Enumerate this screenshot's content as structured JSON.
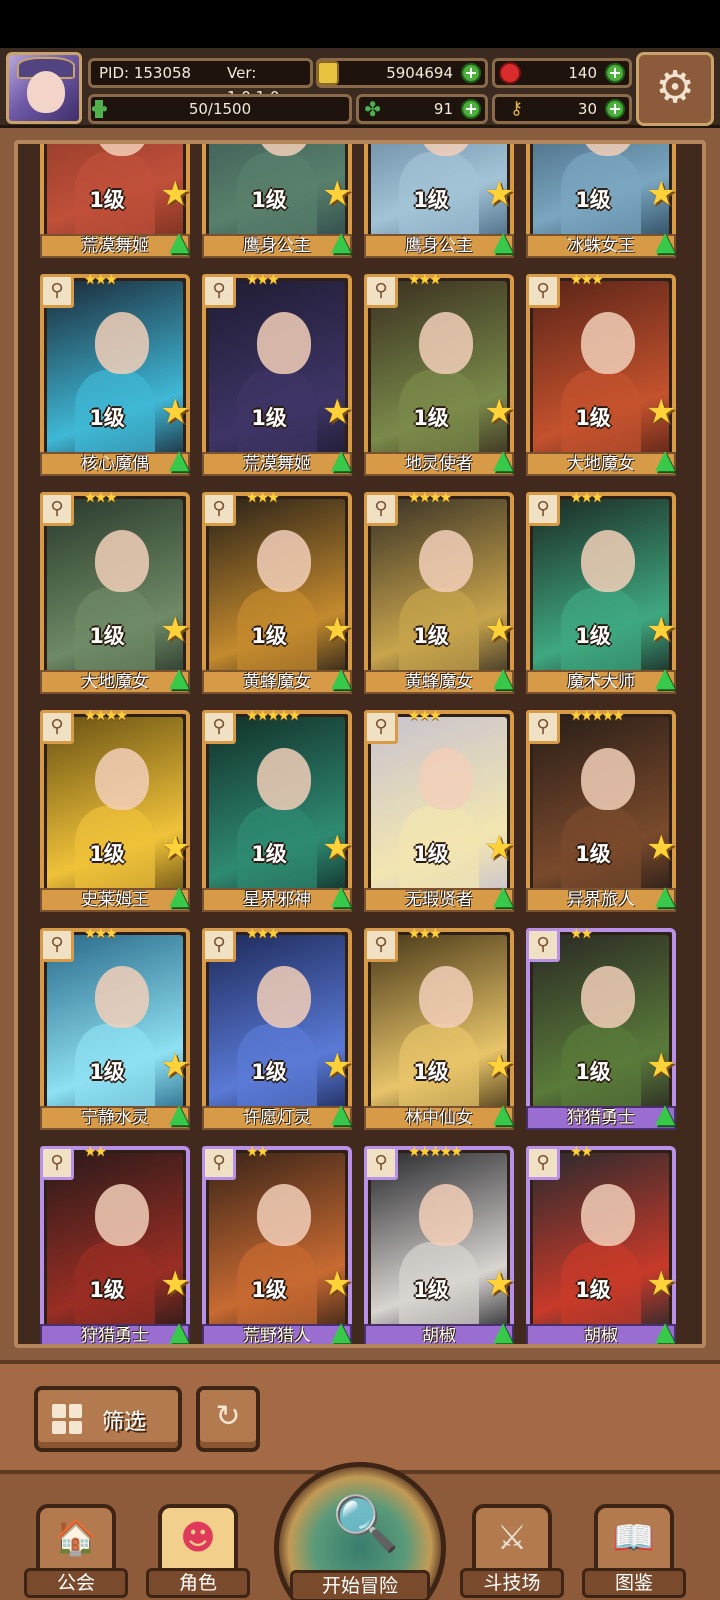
{
  "header": {
    "pid": "PID: 153058",
    "version": "Ver: 1.0.1.0",
    "gold": "5904694",
    "gems": "140",
    "exp": "50/1500",
    "exp_fraction": 0.033,
    "clovers": "91",
    "keys": "30",
    "colors": {
      "bar_bg": "#1e130d",
      "plus": "#4caf3c"
    }
  },
  "cards": [
    {
      "name": "荒漠舞姬",
      "level": "1级",
      "stars": "★★★",
      "tone": "orange",
      "art": [
        "#7a3020",
        "#c0503a"
      ]
    },
    {
      "name": "鹰身公主",
      "level": "1级",
      "stars": "★★★",
      "tone": "orange",
      "art": [
        "#2f4a4a",
        "#58806c"
      ]
    },
    {
      "name": "鹰身公主",
      "level": "1级",
      "stars": "★★★",
      "tone": "orange",
      "art": [
        "#4a6a86",
        "#a3c3d6"
      ]
    },
    {
      "name": "冰蛛女王",
      "level": "1级",
      "stars": "★★★",
      "tone": "orange",
      "art": [
        "#2c4a5e",
        "#7aa6c0"
      ]
    },
    {
      "name": "核心魔偶",
      "level": "1级",
      "stars": "★★★",
      "tone": "orange",
      "art": [
        "#1c2a38",
        "#3fb8d6"
      ]
    },
    {
      "name": "荒漠舞姬",
      "level": "1级",
      "stars": "★★★",
      "tone": "orange",
      "art": [
        "#1f1c33",
        "#3e3566"
      ]
    },
    {
      "name": "地灵使者",
      "level": "1级",
      "stars": "★★★",
      "tone": "orange",
      "art": [
        "#3a3020",
        "#7a8a4a"
      ]
    },
    {
      "name": "大地魔女",
      "level": "1级",
      "stars": "★★★",
      "tone": "orange",
      "art": [
        "#5a2418",
        "#c4522e"
      ]
    },
    {
      "name": "大地魔女",
      "level": "1级",
      "stars": "★★★",
      "tone": "orange",
      "art": [
        "#2a3a2c",
        "#6f8a66"
      ]
    },
    {
      "name": "黄蜂魔女",
      "level": "1级",
      "stars": "★★★",
      "tone": "orange",
      "art": [
        "#2a2218",
        "#c48a2e"
      ]
    },
    {
      "name": "黄蜂魔女",
      "level": "1级",
      "stars": "★★★★",
      "tone": "orange",
      "art": [
        "#3a3326",
        "#c8a44c"
      ]
    },
    {
      "name": "魔术大师",
      "level": "1级",
      "stars": "★★★",
      "tone": "orange",
      "art": [
        "#1c2a24",
        "#3fa880"
      ]
    },
    {
      "name": "史莱姆王",
      "level": "1级",
      "stars": "★★★★",
      "tone": "orange",
      "art": [
        "#6a5214",
        "#f0c23a"
      ]
    },
    {
      "name": "星界邪神",
      "level": "1级",
      "stars": "★★★★★",
      "tone": "orange",
      "art": [
        "#12302a",
        "#2f8a72"
      ]
    },
    {
      "name": "无瑕贤者",
      "level": "1级",
      "stars": "★★★",
      "tone": "orange",
      "art": [
        "#c9c3cf",
        "#f2e6b0"
      ]
    },
    {
      "name": "异界旅人",
      "level": "1级",
      "stars": "★★★★★",
      "tone": "orange",
      "art": [
        "#2a1e18",
        "#7a4a2c"
      ]
    },
    {
      "name": "宁静水灵",
      "level": "1级",
      "stars": "★★★",
      "tone": "orange",
      "art": [
        "#2a6a8a",
        "#8ee0f2"
      ]
    },
    {
      "name": "许愿灯灵",
      "level": "1级",
      "stars": "★★★",
      "tone": "orange",
      "art": [
        "#1e2a5a",
        "#5a7ad6"
      ]
    },
    {
      "name": "林中仙女",
      "level": "1级",
      "stars": "★★★",
      "tone": "orange",
      "art": [
        "#4a3a1a",
        "#e8c46a"
      ]
    },
    {
      "name": "狩猎勇士",
      "level": "1级",
      "stars": "★★",
      "tone": "purple",
      "art": [
        "#2a2a24",
        "#5a7a3a"
      ]
    },
    {
      "name": "狩猎勇士",
      "level": "1级",
      "stars": "★★",
      "tone": "purple",
      "art": [
        "#2a1a1a",
        "#9a2e24"
      ]
    },
    {
      "name": "荒野猎人",
      "level": "1级",
      "stars": "★★",
      "tone": "purple",
      "art": [
        "#3a2418",
        "#c86a32"
      ]
    },
    {
      "name": "胡椒",
      "level": "1级",
      "stars": "★★★★★",
      "tone": "purple",
      "art": [
        "#2a2a2e",
        "#d8d4d0"
      ]
    },
    {
      "name": "胡椒",
      "level": "1级",
      "stars": "★★",
      "tone": "purple",
      "art": [
        "#2a2a2e",
        "#c83a2a"
      ]
    }
  ],
  "filter": {
    "label": "筛选"
  },
  "nav": {
    "guild": "公会",
    "character": "角色",
    "adventure": "开始冒险",
    "arena": "斗技场",
    "codex": "图鉴"
  }
}
